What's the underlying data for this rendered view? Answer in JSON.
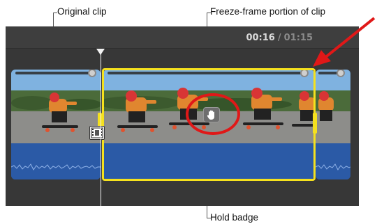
{
  "callouts": {
    "original_clip": "Original clip",
    "freeze_frame": "Freeze-frame portion of clip",
    "hold_badge": "Hold badge"
  },
  "timecode": {
    "current": "00:16",
    "separator": "/",
    "total": "01:15"
  },
  "icons": {
    "hold": "hand-icon",
    "filmstrip": "filmstrip-icon"
  },
  "colors": {
    "selection": "#f5e11e",
    "annotation": "#e01818",
    "audio": "#2b5aa6"
  }
}
